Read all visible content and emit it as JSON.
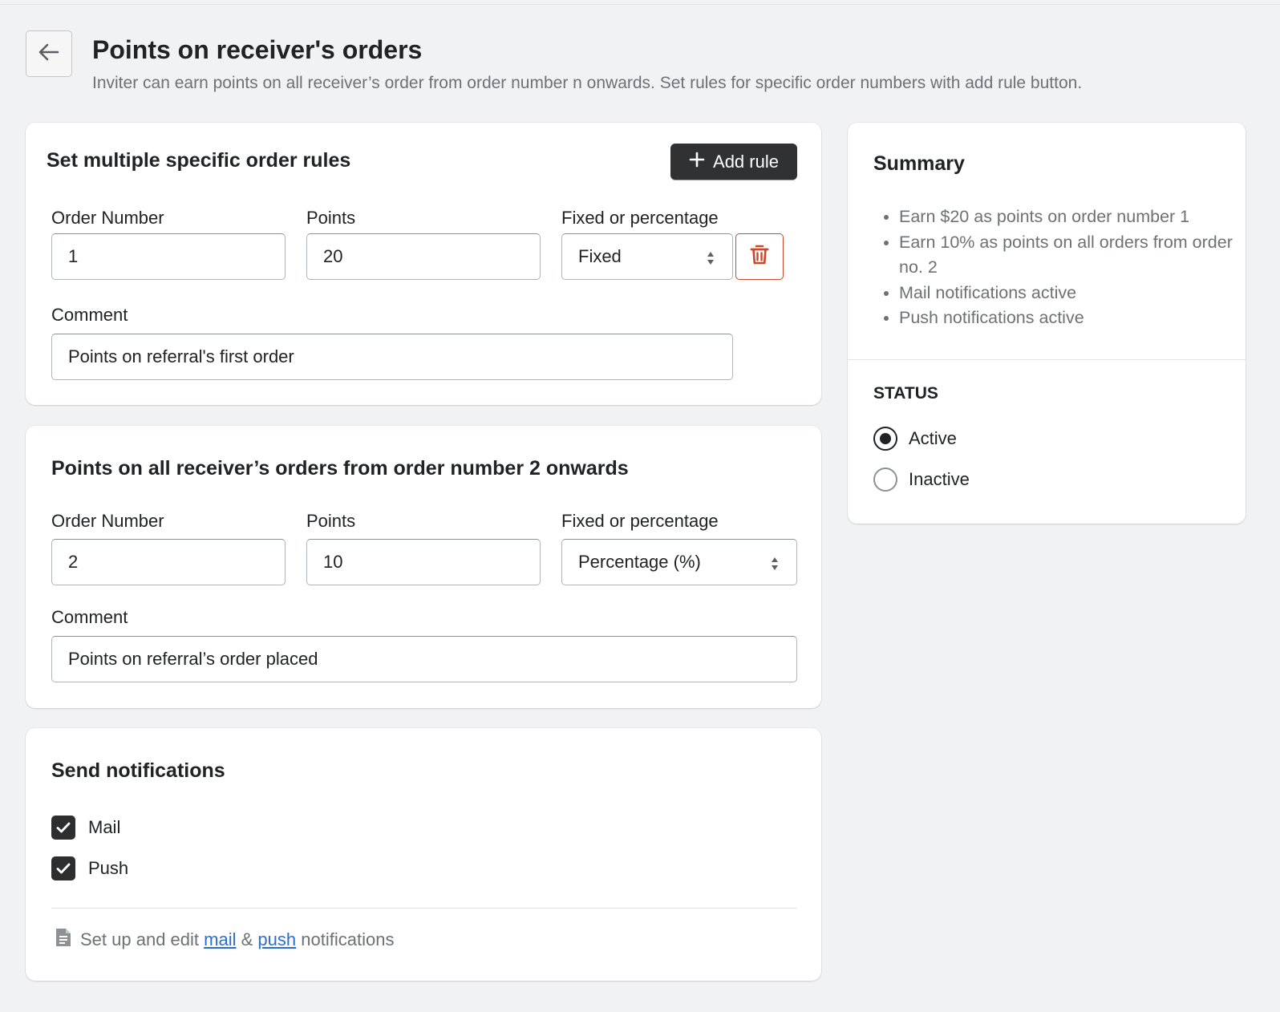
{
  "header": {
    "title": "Points on receiver's orders",
    "subtitle": "Inviter can earn points on all receiver’s order from order number n onwards. Set rules for specific order numbers with add rule button."
  },
  "specific_rules": {
    "heading": "Set multiple specific order rules",
    "add_rule_label": "Add rule",
    "order_number_label": "Order Number",
    "order_number_value": "1",
    "points_label": "Points",
    "points_value": "20",
    "type_label": "Fixed or percentage",
    "type_value": "Fixed",
    "comment_label": "Comment",
    "comment_value": "Points on referral's first order"
  },
  "onwards_rule": {
    "heading": "Points on all receiver’s orders from order number 2 onwards",
    "order_number_label": "Order Number",
    "order_number_value": "2",
    "points_label": "Points",
    "points_value": "10",
    "type_label": "Fixed or percentage",
    "type_value": "Percentage (%)",
    "comment_label": "Comment",
    "comment_value": "Points on referral’s order placed"
  },
  "notifications": {
    "heading": "Send notifications",
    "mail_label": "Mail",
    "mail_checked": true,
    "push_label": "Push",
    "push_checked": true,
    "footer_prefix": "Set up and edit",
    "footer_mail_link": "mail",
    "footer_amp": "&",
    "footer_push_link": "push",
    "footer_suffix": "notifications"
  },
  "summary": {
    "heading": "Summary",
    "items": [
      "Earn $20 as points on order number 1",
      "Earn 10% as points on all orders from order no. 2",
      "Mail notifications active",
      "Push notifications active"
    ],
    "status_label": "STATUS",
    "status_options": [
      "Active",
      "Inactive"
    ],
    "status_selected": "Active"
  },
  "icons": {
    "back": "arrow-left-icon",
    "add": "plus-icon",
    "delete": "trash-icon",
    "select": "select-arrows-icon",
    "check": "checkmark-icon",
    "note": "document-icon"
  },
  "colors": {
    "background": "#f1f2f3",
    "primary_button": "#303132",
    "critical": "#c9482c",
    "link": "#2c6ecb",
    "subdued_text": "#6d7175"
  }
}
